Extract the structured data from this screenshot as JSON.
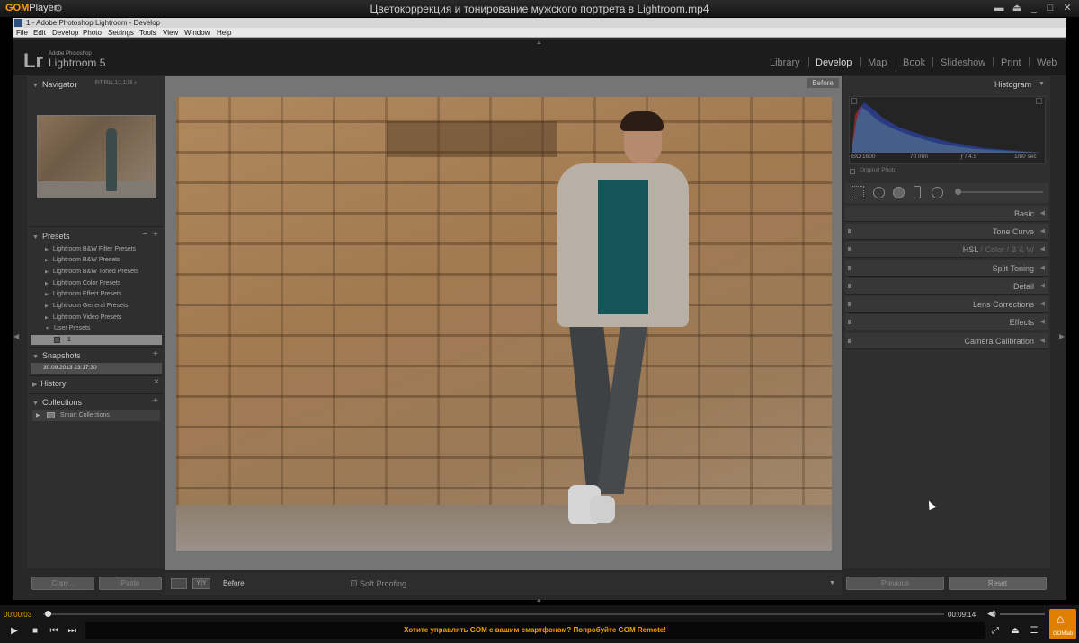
{
  "player": {
    "brand": "GOM",
    "brand_suffix": "Player",
    "filename": "Цветокоррекция и тонирование мужского портрета в Lightroom.mp4",
    "current_time": "00:00:03",
    "total_time": "00:09:14",
    "progress_fraction": 0.005,
    "banner": "Хотите управлять GOM с вашим смартфоном? Попробуйте GOM Remote!",
    "gomlab_label": "GOMlab"
  },
  "window": {
    "title": "1 - Adobe Photoshop Lightroom - Develop",
    "menu": [
      "File",
      "Edit",
      "Develop",
      "Photo",
      "Settings",
      "Tools",
      "View",
      "Window",
      "Help"
    ]
  },
  "lightroom": {
    "logo": "Lr",
    "adobe_line": "Adobe Photoshop",
    "version_line": "Lightroom 5",
    "modules": [
      "Library",
      "Develop",
      "Map",
      "Book",
      "Slideshow",
      "Print",
      "Web"
    ],
    "active_module": "Develop"
  },
  "left_panel": {
    "navigator": {
      "title": "Navigator",
      "zoom": "FIT  FILL  1:1  1:16 ÷"
    },
    "presets": {
      "title": "Presets",
      "items": [
        "Lightroom B&W Filter Presets",
        "Lightroom B&W Presets",
        "Lightroom B&W Toned Presets",
        "Lightroom Color Presets",
        "Lightroom Effect Presets",
        "Lightroom General Presets",
        "Lightroom Video Presets",
        "User Presets"
      ],
      "user_preset": "1"
    },
    "snapshots": {
      "title": "Snapshots",
      "item": "30.09.2013 23:17:30"
    },
    "history": {
      "title": "History"
    },
    "collections": {
      "title": "Collections",
      "item": "Smart Collections"
    },
    "copy_label": "Copy...",
    "paste_label": "Paste"
  },
  "center": {
    "before_label": "Before",
    "toolbar_before": "Before",
    "toolbar_yy": "Y|Y",
    "soft_proofing": "Soft Proofing"
  },
  "right_panel": {
    "histogram_title": "Histogram",
    "iso": "ISO 1600",
    "focal": "70 mm",
    "aperture": "ƒ / 4.5",
    "shutter": "1/80 sec",
    "original_photo": "Original Photo",
    "sections": {
      "basic": "Basic",
      "tone_curve": "Tone Curve",
      "hsl": "HSL",
      "color": "Color",
      "bw": "B & W",
      "split_toning": "Split Toning",
      "detail": "Detail",
      "lens_corrections": "Lens Corrections",
      "effects": "Effects",
      "camera_calibration": "Camera Calibration"
    },
    "previous_label": "Previous",
    "reset_label": "Reset"
  },
  "histogram_data": {
    "series": [
      {
        "name": "red",
        "color": "#d03030"
      },
      {
        "name": "green",
        "color": "#30c040"
      },
      {
        "name": "blue",
        "color": "#3050e0"
      }
    ]
  }
}
